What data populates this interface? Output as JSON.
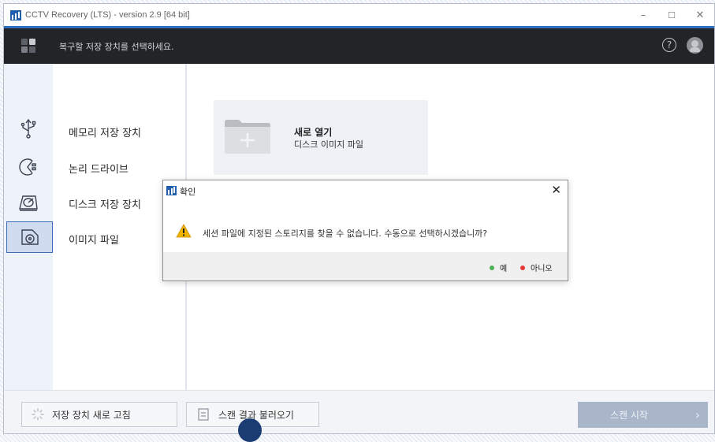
{
  "window": {
    "title": "CCTV Recovery (LTS) - version 2.9 [64 bit]",
    "controls": {
      "minimize": "–",
      "maximize": "☐",
      "close": "✕"
    }
  },
  "header": {
    "instruction": "복구할 저장 장치를 선택하세요.",
    "help_label": "?"
  },
  "sidebar": {
    "items": [
      {
        "label": "메모리 저장 장치",
        "icon": "usb-icon"
      },
      {
        "label": "논리 드라이브",
        "icon": "pie-drive-icon"
      },
      {
        "label": "디스크 저장 장치",
        "icon": "hard-disk-icon"
      },
      {
        "label": "이미지 파일",
        "icon": "disk-image-icon",
        "active": true
      }
    ]
  },
  "content": {
    "open_card": {
      "title": "새로 열기",
      "subtitle": "디스크 이미지 파일"
    }
  },
  "dialog": {
    "title": "확인",
    "close": "✕",
    "message": "세션 파일에 지정된 스토리지를 찾을 수 없습니다. 수동으로 선택하시겠습니까?",
    "yes_label": "예",
    "no_label": "아니오",
    "yes_color": "#4caf50",
    "no_color": "#e53935"
  },
  "footer": {
    "refresh_label": "저장 장치 새로 고침",
    "load_label": "스캔 결과 불러오기",
    "scan_label": "스캔 시작",
    "scan_arrow": "›"
  }
}
